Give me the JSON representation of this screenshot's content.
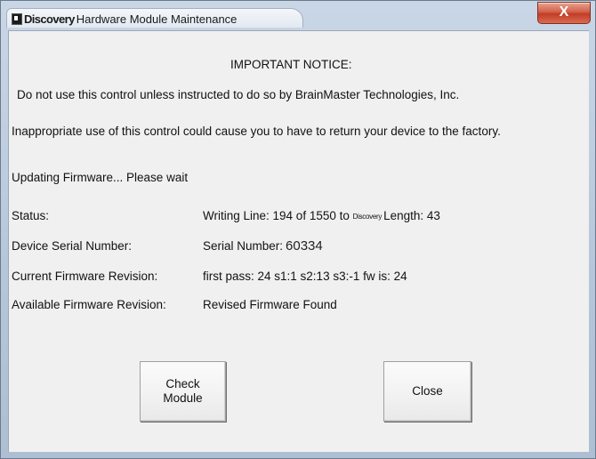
{
  "window": {
    "title_brand": "Discovery",
    "title_rest": "Hardware Module Maintenance",
    "close_glyph": "X"
  },
  "notice": {
    "heading": "IMPORTANT NOTICE:",
    "line1": "Do not use this control unless instructed to do so by BrainMaster Technologies, Inc.",
    "line2": "Inappropriate use of this control could cause you to have to return your device to the factory."
  },
  "progress_message": "Updating Firmware... Please wait",
  "fields": {
    "status_label": "Status:",
    "status_prefix": "Writing Line: 194 of 1550 to",
    "status_brand": "Discovery",
    "status_suffix": "Length: 43",
    "serial_label": "Device Serial Number:",
    "serial_prefix": "Serial Number:",
    "serial_value": "60334",
    "current_label": "Current Firmware Revision:",
    "current_value": "first pass: 24 s1:1 s2:13 s3:-1 fw is: 24",
    "available_label": "Available Firmware Revision:",
    "available_value": "Revised Firmware Found"
  },
  "buttons": {
    "check_module": "Check\nModule",
    "close": "Close"
  }
}
